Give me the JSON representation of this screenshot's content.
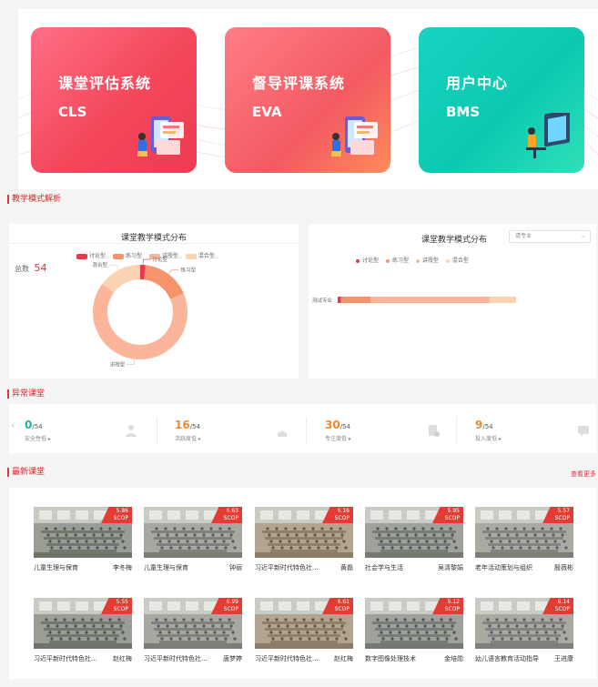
{
  "systems": [
    {
      "title": "课堂评估系统",
      "code": "CLS"
    },
    {
      "title": "督导评课系统",
      "code": "EVA"
    },
    {
      "title": "用户中心",
      "code": "BMS"
    }
  ],
  "teaching_section": {
    "title": "教学模式解析",
    "left_panel": {
      "title": "课堂教学模式分布",
      "total_label": "总数",
      "total_value": "54"
    },
    "right_panel": {
      "title": "课堂教学模式分布",
      "select_value": "请专业",
      "row_label": "测试专业"
    }
  },
  "legend": [
    {
      "name": "讨论型",
      "color": "#e8384f"
    },
    {
      "name": "练习型",
      "color": "#f5946b"
    },
    {
      "name": "讲授型",
      "color": "#fbb59b"
    },
    {
      "name": "混合型",
      "color": "#fbd3b3"
    }
  ],
  "chart_data": [
    {
      "type": "pie",
      "title": "课堂教学模式分布",
      "categories": [
        "讨论型",
        "练习型",
        "讲授型",
        "混合型"
      ],
      "values": [
        1,
        9,
        36,
        8
      ],
      "slice_labels": [
        "讨论型",
        "练习型",
        "讲授型",
        "混合型"
      ]
    },
    {
      "type": "bar",
      "title": "课堂教学模式分布",
      "categories": [
        "测试专业"
      ],
      "series": [
        {
          "name": "讨论型",
          "values": [
            1
          ]
        },
        {
          "name": "练习型",
          "values": [
            9
          ]
        },
        {
          "name": "讲授型",
          "values": [
            36
          ]
        },
        {
          "name": "混合型",
          "values": [
            8
          ]
        }
      ]
    }
  ],
  "abnormal_section": {
    "title": "异常课堂",
    "stats": [
      {
        "value": "0",
        "total": "/54",
        "label": "安全性低 ▸",
        "color": "#19b5a2"
      },
      {
        "value": "16",
        "total": "/54",
        "label": "活跃度低 ▸",
        "color": "#f0892c"
      },
      {
        "value": "30",
        "total": "/54",
        "label": "专注度低 ▸",
        "color": "#f0892c"
      },
      {
        "value": "9",
        "total": "/54",
        "label": "投入度低 ▸",
        "color": "#f0892c"
      }
    ]
  },
  "latest_section": {
    "title": "最新课堂",
    "more": "查看更多",
    "videos": [
      {
        "score": "5.86",
        "tag": "SCOP",
        "title": "儿童生理与保育",
        "teacher": "李冬梅"
      },
      {
        "score": "6.63",
        "tag": "SCOP",
        "title": "儿童生理与保育",
        "teacher": "钟丽"
      },
      {
        "score": "6.16",
        "tag": "SCOP",
        "title": "习近平新时代特色社...",
        "teacher": "黄磊"
      },
      {
        "score": "5.95",
        "tag": "SCOP",
        "title": "社会学与生活",
        "teacher": "吴清黎娟"
      },
      {
        "score": "5.57",
        "tag": "SCOP",
        "title": "老年活动策划与组织",
        "teacher": "殷薇彬"
      },
      {
        "score": "5.55",
        "tag": "SCOP",
        "title": "习近平新时代特色社...",
        "teacher": "赵红梅"
      },
      {
        "score": "6.99",
        "tag": "SCOP",
        "title": "习近平新时代特色社...",
        "teacher": "唐梦婷"
      },
      {
        "score": "6.61",
        "tag": "SCOP",
        "title": "习近平新时代特色社...",
        "teacher": "赵红梅"
      },
      {
        "score": "5.12",
        "tag": "SCOP",
        "title": "数字图像处理技术",
        "teacher": "金培勋"
      },
      {
        "score": "6.14",
        "tag": "SCOP",
        "title": "幼儿语言教育活动指导",
        "teacher": "王进康"
      }
    ]
  }
}
